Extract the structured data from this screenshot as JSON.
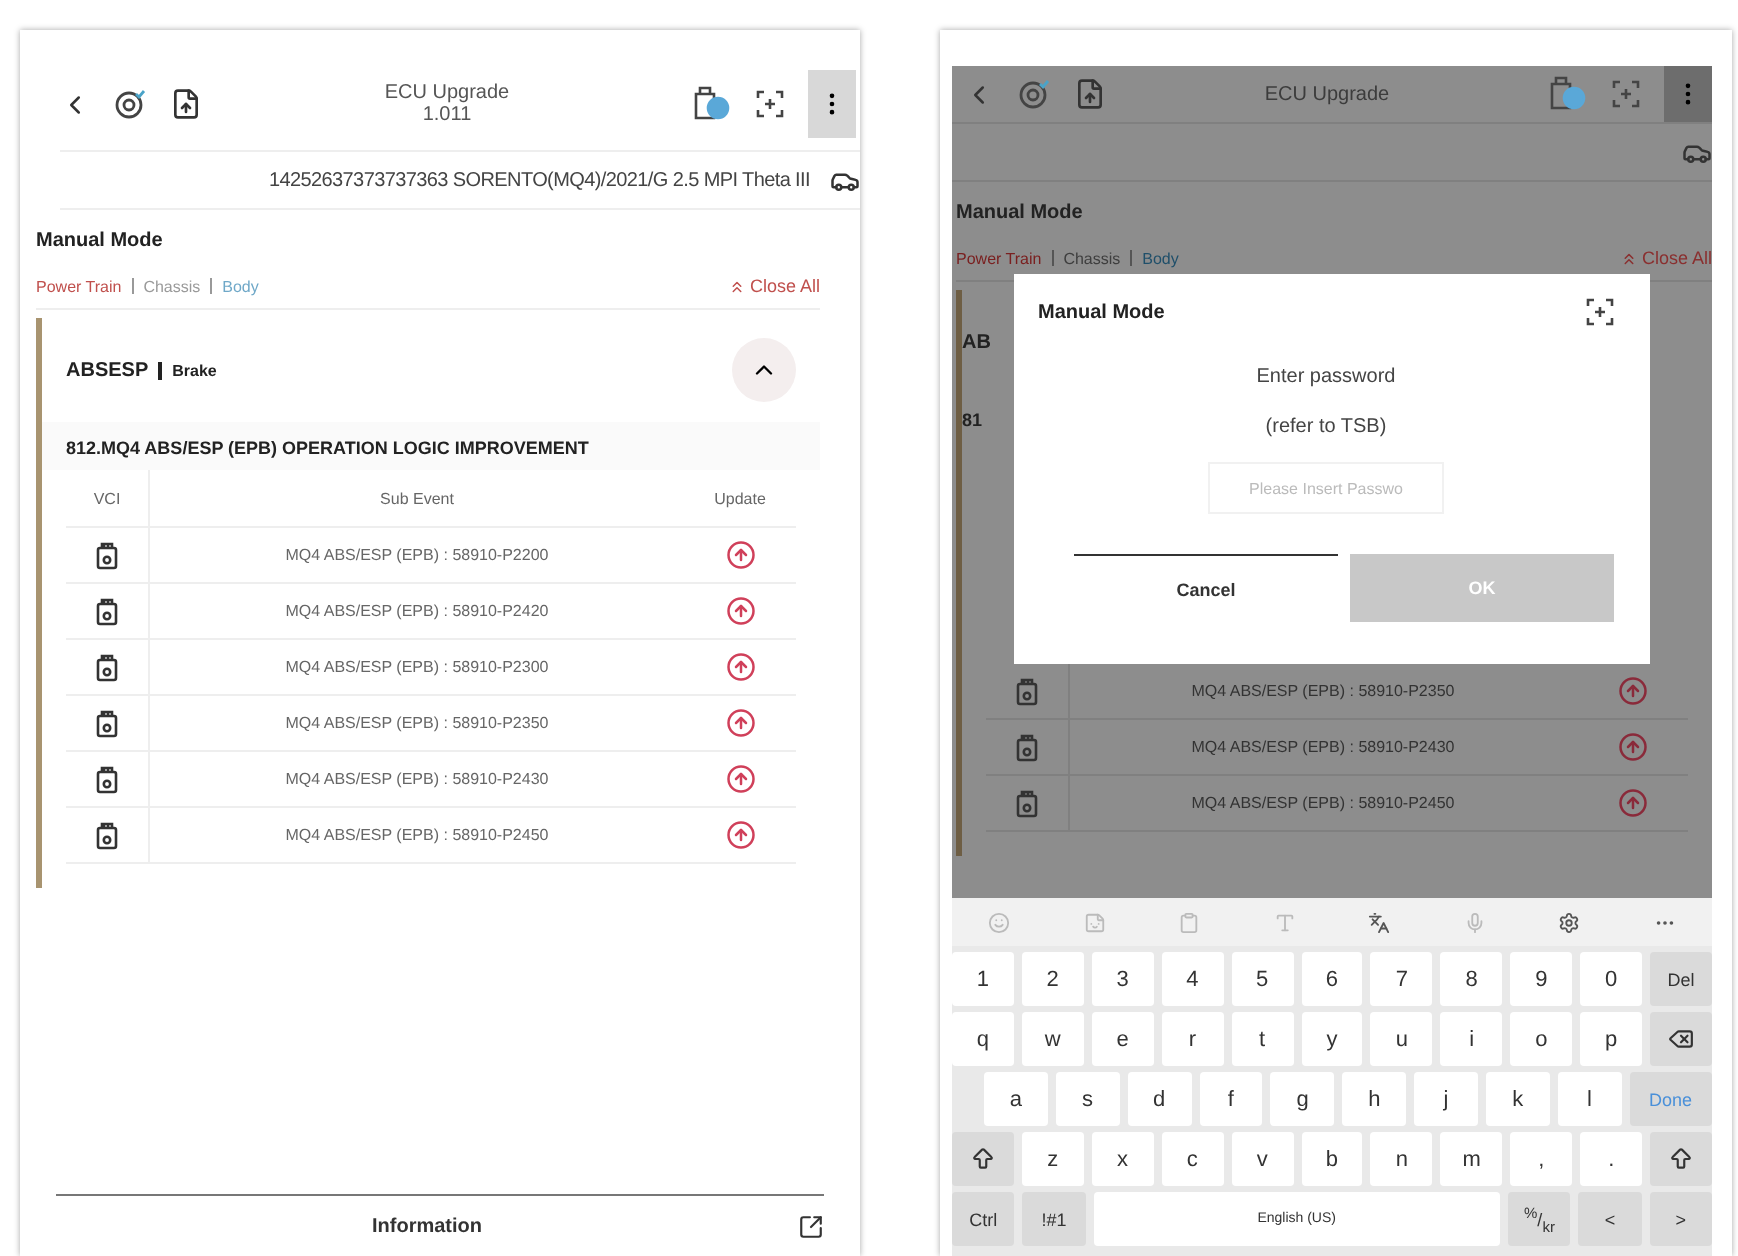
{
  "left_screen": {
    "header": {
      "title": "ECU Upgrade",
      "version": "1.011"
    },
    "vehicle": "14252637373737363 SORENTO(MQ4)/2021/G 2.5 MPI Theta III",
    "section_title": "Manual Mode",
    "categories": [
      {
        "label": "Power Train",
        "color": "#c0504d"
      },
      {
        "label": "Chassis",
        "color": "#9a9a9a"
      },
      {
        "label": "Body",
        "color": "#6fa8c8"
      }
    ],
    "close_all": "Close All",
    "module": {
      "name": "ABSESP",
      "system": "Brake",
      "expanded": true
    },
    "event_title": "812.MQ4 ABS/ESP (EPB) OPERATION LOGIC IMPROVEMENT",
    "table": {
      "columns": [
        "VCI",
        "Sub Event",
        "Update"
      ],
      "rows": [
        {
          "sub_event": "MQ4 ABS/ESP (EPB) : 58910-P2200"
        },
        {
          "sub_event": "MQ4 ABS/ESP (EPB) : 58910-P2420"
        },
        {
          "sub_event": "MQ4 ABS/ESP (EPB) : 58910-P2300"
        },
        {
          "sub_event": "MQ4 ABS/ESP (EPB) : 58910-P2350"
        },
        {
          "sub_event": "MQ4 ABS/ESP (EPB) : 58910-P2430"
        },
        {
          "sub_event": "MQ4 ABS/ESP (EPB) : 58910-P2450"
        }
      ]
    },
    "footer": "Information"
  },
  "right_screen": {
    "header": {
      "title": "ECU Upgrade"
    },
    "section_title": "Manual Mode",
    "categories": [
      {
        "label": "Power Train",
        "color": "#7a2020"
      },
      {
        "label": "Chassis",
        "color": "#3e3e3e"
      },
      {
        "label": "Body",
        "color": "#1f4f6a"
      }
    ],
    "close_all": "Close All",
    "module": {
      "name": "AB"
    },
    "event_title": "81",
    "table": {
      "rows": [
        {
          "sub_event": "MQ4 ABS/ESP (EPB) : 58910-P2350"
        },
        {
          "sub_event": "MQ4 ABS/ESP (EPB) : 58910-P2430"
        },
        {
          "sub_event": "MQ4 ABS/ESP (EPB) : 58910-P2450"
        }
      ]
    },
    "dialog": {
      "title": "Manual Mode",
      "lines": [
        "Enter password",
        "(refer to TSB)"
      ],
      "placeholder": "Please Insert Passwo",
      "buttons": [
        {
          "label": "Cancel",
          "kind": "cancel",
          "disabled": false
        },
        {
          "label": "OK",
          "kind": "ok",
          "disabled": true
        }
      ]
    },
    "keyboard": {
      "rows": [
        [
          {
            "label": "1",
            "kind": "char"
          },
          {
            "label": "2",
            "kind": "char"
          },
          {
            "label": "3",
            "kind": "char"
          },
          {
            "label": "4",
            "kind": "char"
          },
          {
            "label": "5",
            "kind": "char"
          },
          {
            "label": "6",
            "kind": "char"
          },
          {
            "label": "7",
            "kind": "char"
          },
          {
            "label": "8",
            "kind": "char"
          },
          {
            "label": "9",
            "kind": "char"
          },
          {
            "label": "0",
            "kind": "char"
          },
          {
            "label": "Del",
            "kind": "function"
          }
        ],
        [
          {
            "label": "q",
            "kind": "char"
          },
          {
            "label": "w",
            "kind": "char"
          },
          {
            "label": "e",
            "kind": "char"
          },
          {
            "label": "r",
            "kind": "char"
          },
          {
            "label": "t",
            "kind": "char"
          },
          {
            "label": "y",
            "kind": "char"
          },
          {
            "label": "u",
            "kind": "char"
          },
          {
            "label": "i",
            "kind": "char"
          },
          {
            "label": "o",
            "kind": "char"
          },
          {
            "label": "p",
            "kind": "char"
          },
          {
            "kind": "backspace"
          }
        ],
        [
          {
            "kind": "gap"
          },
          {
            "label": "a",
            "kind": "char"
          },
          {
            "label": "s",
            "kind": "char"
          },
          {
            "label": "d",
            "kind": "char"
          },
          {
            "label": "f",
            "kind": "char"
          },
          {
            "label": "g",
            "kind": "char"
          },
          {
            "label": "h",
            "kind": "char"
          },
          {
            "label": "j",
            "kind": "char"
          },
          {
            "label": "k",
            "kind": "char"
          },
          {
            "label": "l",
            "kind": "char"
          },
          {
            "label": "Done",
            "kind": "done"
          }
        ],
        [
          {
            "kind": "shift"
          },
          {
            "label": "z",
            "kind": "char"
          },
          {
            "label": "x",
            "kind": "char"
          },
          {
            "label": "c",
            "kind": "char"
          },
          {
            "label": "v",
            "kind": "char"
          },
          {
            "label": "b",
            "kind": "char"
          },
          {
            "label": "n",
            "kind": "char"
          },
          {
            "label": "m",
            "kind": "char"
          },
          {
            "label": ",",
            "kind": "char"
          },
          {
            "label": ".",
            "kind": "char"
          },
          {
            "kind": "shift"
          }
        ]
      ],
      "bottom_row": [
        {
          "label": "Ctrl",
          "kind": "function"
        },
        {
          "label": "!#1",
          "kind": "function"
        },
        {
          "label": "English (US)",
          "kind": "space"
        },
        {
          "label": "$^{%}$/$_{kr}$",
          "kind": "function"
        },
        {
          "label": "<",
          "kind": "function"
        },
        {
          "label": ">",
          "kind": "function"
        }
      ]
    }
  }
}
